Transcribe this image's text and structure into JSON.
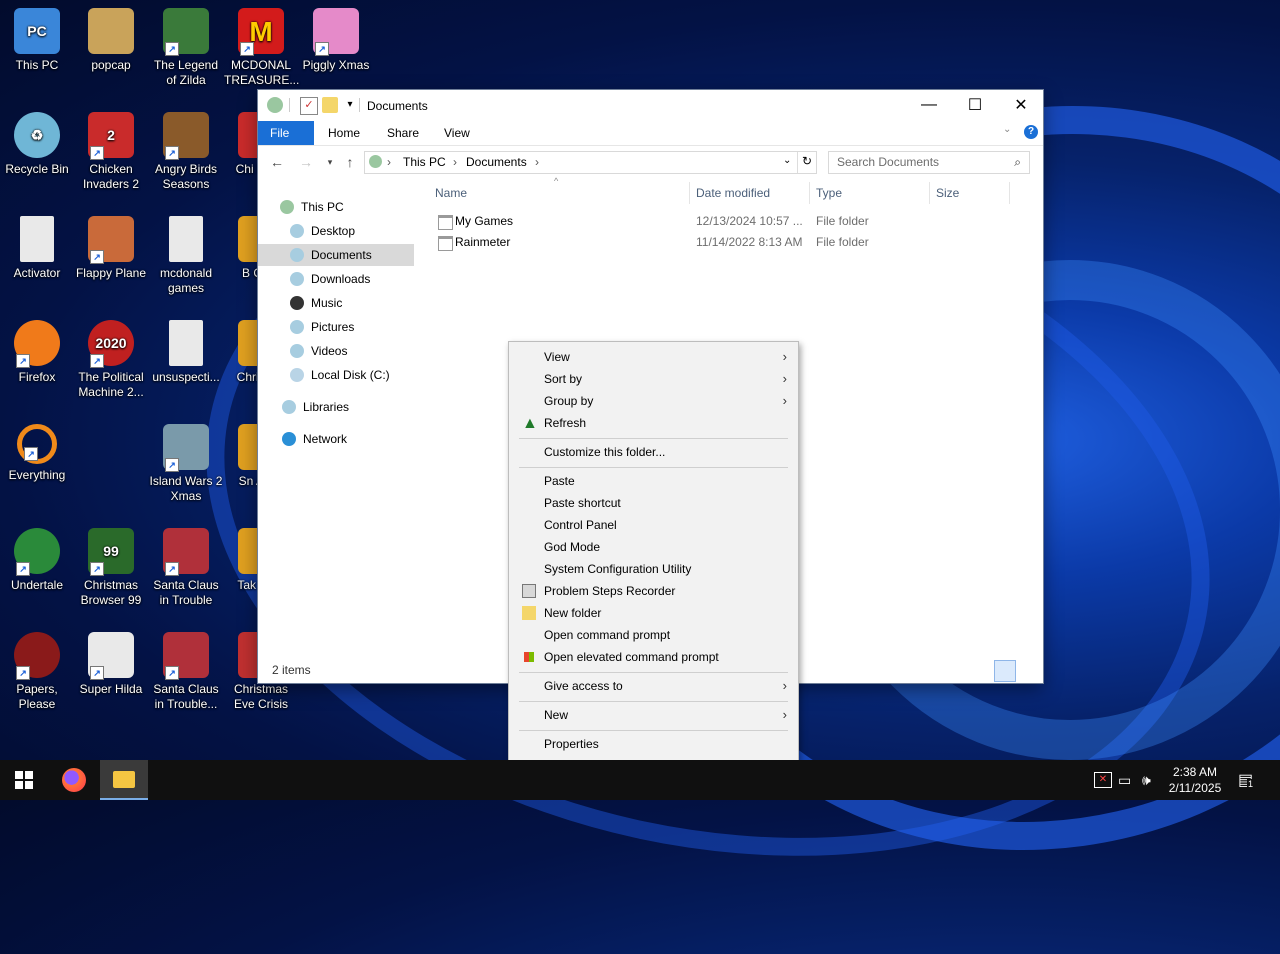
{
  "desktop": {
    "icons": [
      {
        "label": "This PC",
        "color": "#3a86d9"
      },
      {
        "label": "popcap",
        "color": "#c9a35a"
      },
      {
        "label": "The Legend of Zilda",
        "color": "#3a7a3a"
      },
      {
        "label": "MCDONAL TREASURE...",
        "color": "#d31b1b"
      },
      {
        "label": "Piggly Xmas",
        "color": "#e58ac9"
      },
      {
        "label": "Recycle Bin",
        "color": "#6fb6d6"
      },
      {
        "label": "Chicken Invaders 2",
        "color": "#c92b2b"
      },
      {
        "label": "Angry Birds Seasons",
        "color": "#8a5a2a"
      },
      {
        "label": "Chi Invad",
        "color": "#c92b2b"
      },
      {
        "label": "Activator",
        "color": "#e9e9e9"
      },
      {
        "label": "Flappy Plane",
        "color": "#c96a3a"
      },
      {
        "label": "mcdonald games",
        "color": "#e9e9e9"
      },
      {
        "label": "B Orna",
        "color": "#e0a020"
      },
      {
        "label": "Firefox",
        "color": "#f07a1a"
      },
      {
        "label": "The Political Machine 2...",
        "color": "#c02020"
      },
      {
        "label": "unsuspecti...",
        "color": "#e9e9e9"
      },
      {
        "label": "Chri Swe",
        "color": "#e0a020"
      },
      {
        "label": "Everything",
        "color": "#f08a1a"
      },
      {
        "label": "Island Wars 2 Xmas",
        "color": "#7a9aaa"
      },
      {
        "label": "Sn Anim",
        "color": "#e0a020"
      },
      {
        "label": "Undertale",
        "color": "#2a8a3a"
      },
      {
        "label": "Christmas Browser 99",
        "color": "#2a6a2a"
      },
      {
        "label": "Santa Claus in Trouble",
        "color": "#b0303a"
      },
      {
        "label": "Tak Brea",
        "color": "#e0a020"
      },
      {
        "label": "Papers, Please",
        "color": "#8a1a1a"
      },
      {
        "label": "Super Hilda",
        "color": "#e9e9e9"
      },
      {
        "label": "Santa Claus in Trouble...",
        "color": "#b0303a"
      },
      {
        "label": "Christmas Eve Crisis",
        "color": "#c03030"
      }
    ]
  },
  "explorer": {
    "title": "Documents",
    "caption": {
      "minimize": "—",
      "maximize": "☐",
      "close": "✕"
    },
    "ribbon_tabs": [
      "File",
      "Home",
      "Share",
      "View"
    ],
    "address": {
      "crumb1": "This PC",
      "crumb2": "Documents"
    },
    "search_placeholder": "Search Documents",
    "nav": {
      "this_pc": "This PC",
      "items": [
        "Desktop",
        "Documents",
        "Downloads",
        "Music",
        "Pictures",
        "Videos",
        "Local Disk (C:)"
      ],
      "libraries": "Libraries",
      "network": "Network"
    },
    "columns": {
      "name": "Name",
      "date": "Date modified",
      "type": "Type",
      "size": "Size"
    },
    "files": [
      {
        "name": "My Games",
        "date": "12/13/2024 10:57 ...",
        "type": "File folder"
      },
      {
        "name": "Rainmeter",
        "date": "11/14/2022 8:13 AM",
        "type": "File folder"
      }
    ],
    "status": "2 items"
  },
  "context_menu": {
    "view": "View",
    "sort_by": "Sort by",
    "group_by": "Group by",
    "refresh": "Refresh",
    "customize": "Customize this folder...",
    "paste": "Paste",
    "paste_shortcut": "Paste shortcut",
    "control_panel": "Control Panel",
    "god_mode": "God Mode",
    "msconfig": "System Configuration Utility",
    "psr": "Problem Steps Recorder",
    "new_folder": "New folder",
    "cmd": "Open command prompt",
    "cmd_elevated": "Open elevated command prompt",
    "give_access": "Give access to",
    "new": "New",
    "properties": "Properties"
  },
  "taskbar": {
    "time": "2:38 AM",
    "date": "2/11/2025",
    "notification_count": "1"
  }
}
